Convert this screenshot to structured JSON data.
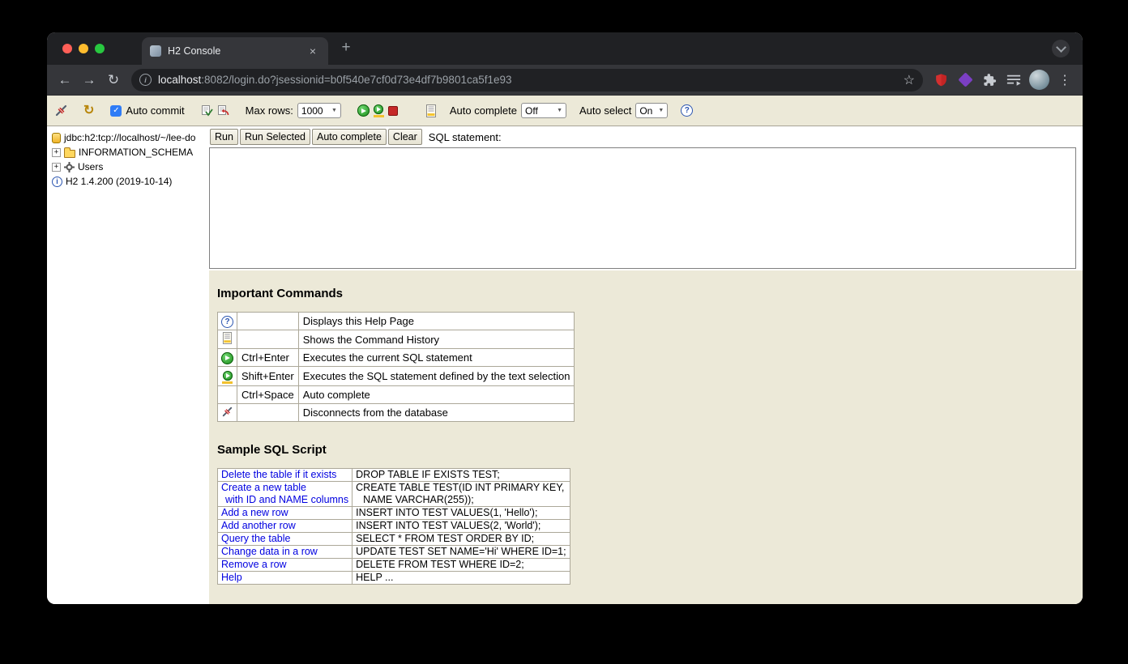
{
  "browser": {
    "tab_title": "H2 Console",
    "url": {
      "host": "localhost",
      "rest": ":8082/login.do?jsessionid=b0f540e7cf0d73e4df7b9801ca5f1e93"
    }
  },
  "icons": {
    "back": "←",
    "forward": "→",
    "reload": "↻",
    "refresh": "↻",
    "info": "i",
    "star": "☆",
    "menu": "⋮",
    "tab_close": "×",
    "new_tab": "+",
    "help": "?",
    "check": "✓",
    "select_arrow": "▼",
    "expander": "+"
  },
  "h2_toolbar": {
    "auto_commit": "Auto commit",
    "max_rows_label": "Max rows:",
    "max_rows_value": "1000",
    "autocomplete_label": "Auto complete",
    "autocomplete_value": "Off",
    "autoselect_label": "Auto select",
    "autoselect_value": "On"
  },
  "sidebar": {
    "items": [
      {
        "label": "jdbc:h2:tcp://localhost/~/lee-do"
      },
      {
        "label": "INFORMATION_SCHEMA"
      },
      {
        "label": "Users"
      },
      {
        "label": "H2 1.4.200 (2019-10-14)"
      }
    ]
  },
  "query": {
    "run": "Run",
    "run_selected": "Run Selected",
    "auto_complete": "Auto complete",
    "clear": "Clear",
    "sql_label": "SQL statement:"
  },
  "help": {
    "commands_title": "Important Commands",
    "commands": [
      {
        "key": "",
        "text": "Displays this Help Page"
      },
      {
        "key": "",
        "text": "Shows the Command History"
      },
      {
        "key": "Ctrl+Enter",
        "text": "Executes the current SQL statement"
      },
      {
        "key": "Shift+Enter",
        "text": "Executes the SQL statement defined by the text selection"
      },
      {
        "key": "Ctrl+Space",
        "text": "Auto complete"
      },
      {
        "key": "",
        "text": "Disconnects from the database"
      }
    ],
    "script_title": "Sample SQL Script",
    "script": [
      {
        "l1": "Delete the table if it exists",
        "s1": "DROP TABLE IF EXISTS TEST;"
      },
      {
        "l1": "Create a new table",
        "l2": "with ID and NAME columns",
        "s1": "CREATE TABLE TEST(ID INT PRIMARY KEY,",
        "s2": "NAME VARCHAR(255));"
      },
      {
        "l1": "Add a new row",
        "s1": "INSERT INTO TEST VALUES(1, 'Hello');"
      },
      {
        "l1": "Add another row",
        "s1": "INSERT INTO TEST VALUES(2, 'World');"
      },
      {
        "l1": "Query the table",
        "s1": "SELECT * FROM TEST ORDER BY ID;"
      },
      {
        "l1": "Change data in a row",
        "s1": "UPDATE TEST SET NAME='Hi' WHERE ID=1;"
      },
      {
        "l1": "Remove a row",
        "s1": "DELETE FROM TEST WHERE ID=2;"
      },
      {
        "l1": "Help",
        "s1": "HELP ..."
      }
    ]
  }
}
